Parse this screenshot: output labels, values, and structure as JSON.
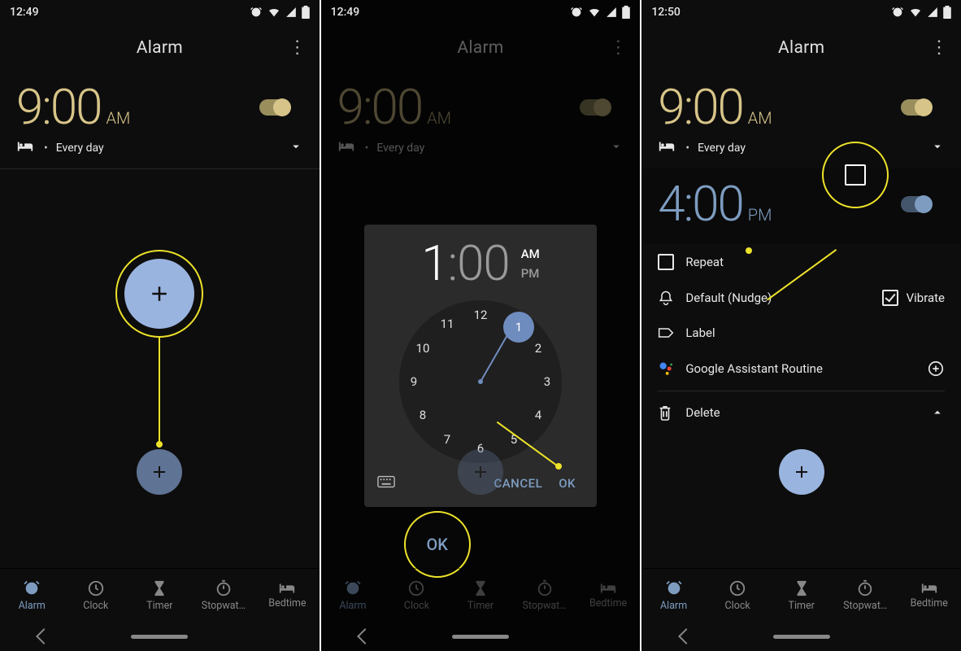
{
  "screens": [
    {
      "statusbar": {
        "time": "12:49"
      },
      "header": {
        "title": "Alarm"
      },
      "alarm": {
        "time": "9:00",
        "ampm": "AM",
        "repeat": "Every day"
      },
      "tabs": [
        "Alarm",
        "Clock",
        "Timer",
        "Stopwat…",
        "Bedtime"
      ]
    },
    {
      "statusbar": {
        "time": "12:49"
      },
      "header": {
        "title": "Alarm"
      },
      "alarm": {
        "time": "9:00",
        "ampm": "AM",
        "repeat": "Every day"
      },
      "dialog": {
        "hour": "1",
        "minute": "00",
        "am": "AM",
        "pm": "PM",
        "cancel": "CANCEL",
        "ok": "OK",
        "numbers": [
          "12",
          "1",
          "2",
          "3",
          "4",
          "5",
          "6",
          "7",
          "8",
          "9",
          "10",
          "11"
        ]
      },
      "callout": "OK",
      "tabs": [
        "Alarm",
        "Clock",
        "Timer",
        "Stopwat…",
        "Bedtime"
      ]
    },
    {
      "statusbar": {
        "time": "12:50"
      },
      "header": {
        "title": "Alarm"
      },
      "alarm": {
        "time": "9:00",
        "ampm": "AM",
        "repeat": "Every day"
      },
      "alarm2": {
        "time": "4:00",
        "ampm": "PM"
      },
      "options": {
        "repeat": "Repeat",
        "sound": "Default (Nudge)",
        "vibrate": "Vibrate",
        "label": "Label",
        "assistant": "Google Assistant Routine",
        "delete": "Delete"
      },
      "tabs": [
        "Alarm",
        "Clock",
        "Timer",
        "Stopwat…",
        "Bedtime"
      ]
    }
  ]
}
